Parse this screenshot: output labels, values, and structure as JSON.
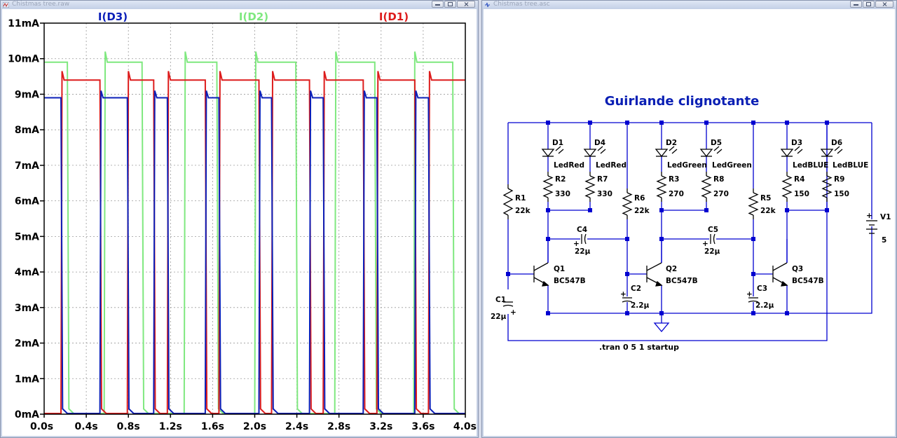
{
  "plot_window": {
    "title": "Chistmas tree.raw",
    "controls": [
      "minimize",
      "restore",
      "close"
    ]
  },
  "schematic_window": {
    "title": "Chistmas tree.asc",
    "controls": [
      "minimize",
      "restore",
      "close"
    ],
    "schematic": {
      "title": "Guirlande clignotante",
      "directive": ".tran 0 5 1 startup",
      "components": [
        {
          "ref": "D1",
          "value": "LedRed"
        },
        {
          "ref": "D4",
          "value": "LedRed"
        },
        {
          "ref": "D2",
          "value": "LedGreen"
        },
        {
          "ref": "D5",
          "value": "LedGreen"
        },
        {
          "ref": "D3",
          "value": "LedBLUE"
        },
        {
          "ref": "D6",
          "value": "LedBLUE"
        },
        {
          "ref": "R2",
          "value": "330"
        },
        {
          "ref": "R7",
          "value": "330"
        },
        {
          "ref": "R3",
          "value": "270"
        },
        {
          "ref": "R8",
          "value": "270"
        },
        {
          "ref": "R4",
          "value": "150"
        },
        {
          "ref": "R9",
          "value": "150"
        },
        {
          "ref": "R1",
          "value": "22k"
        },
        {
          "ref": "R6",
          "value": "22k"
        },
        {
          "ref": "R5",
          "value": "22k"
        },
        {
          "ref": "C4",
          "value": "22µ"
        },
        {
          "ref": "C5",
          "value": "22µ"
        },
        {
          "ref": "C1",
          "value": "22µ"
        },
        {
          "ref": "C2",
          "value": "2.2µ"
        },
        {
          "ref": "C3",
          "value": "2.2µ"
        },
        {
          "ref": "Q1",
          "value": "BC547B"
        },
        {
          "ref": "Q2",
          "value": "BC547B"
        },
        {
          "ref": "Q3",
          "value": "BC547B"
        },
        {
          "ref": "V1",
          "value": "5"
        }
      ]
    }
  },
  "colors": {
    "d3_blue": "#0b1fb8",
    "d2_green": "#7fe87f",
    "d1_red": "#dd1c1c",
    "wire": "#0000d0",
    "title_blue": "#0a1fb4"
  },
  "chart_data": {
    "type": "line",
    "title": "",
    "xlabel": "",
    "ylabel": "",
    "xlim": [
      0,
      4.0
    ],
    "ylim": [
      0,
      11
    ],
    "x_ticks": [
      "0.0s",
      "0.4s",
      "0.8s",
      "1.2s",
      "1.6s",
      "2.0s",
      "2.4s",
      "2.8s",
      "3.2s",
      "3.6s",
      "4.0s"
    ],
    "y_ticks": [
      "0mA",
      "1mA",
      "2mA",
      "3mA",
      "4mA",
      "5mA",
      "6mA",
      "7mA",
      "8mA",
      "9mA",
      "10mA",
      "11mA"
    ],
    "grid": true,
    "legend_position": "top",
    "series": [
      {
        "name": "I(D3)",
        "color": "#0b1fb8",
        "on_level": 8.9,
        "off_level": 0.0,
        "on_intervals": [
          [
            0.0,
            0.16
          ],
          [
            0.53,
            0.79
          ],
          [
            1.04,
            1.17
          ],
          [
            1.53,
            1.66
          ],
          [
            2.04,
            2.16
          ],
          [
            2.52,
            2.65
          ],
          [
            3.03,
            3.16
          ],
          [
            3.52,
            3.65
          ],
          [
            4.0,
            4.0
          ]
        ],
        "points_note": ""
      }
    ]
  }
}
